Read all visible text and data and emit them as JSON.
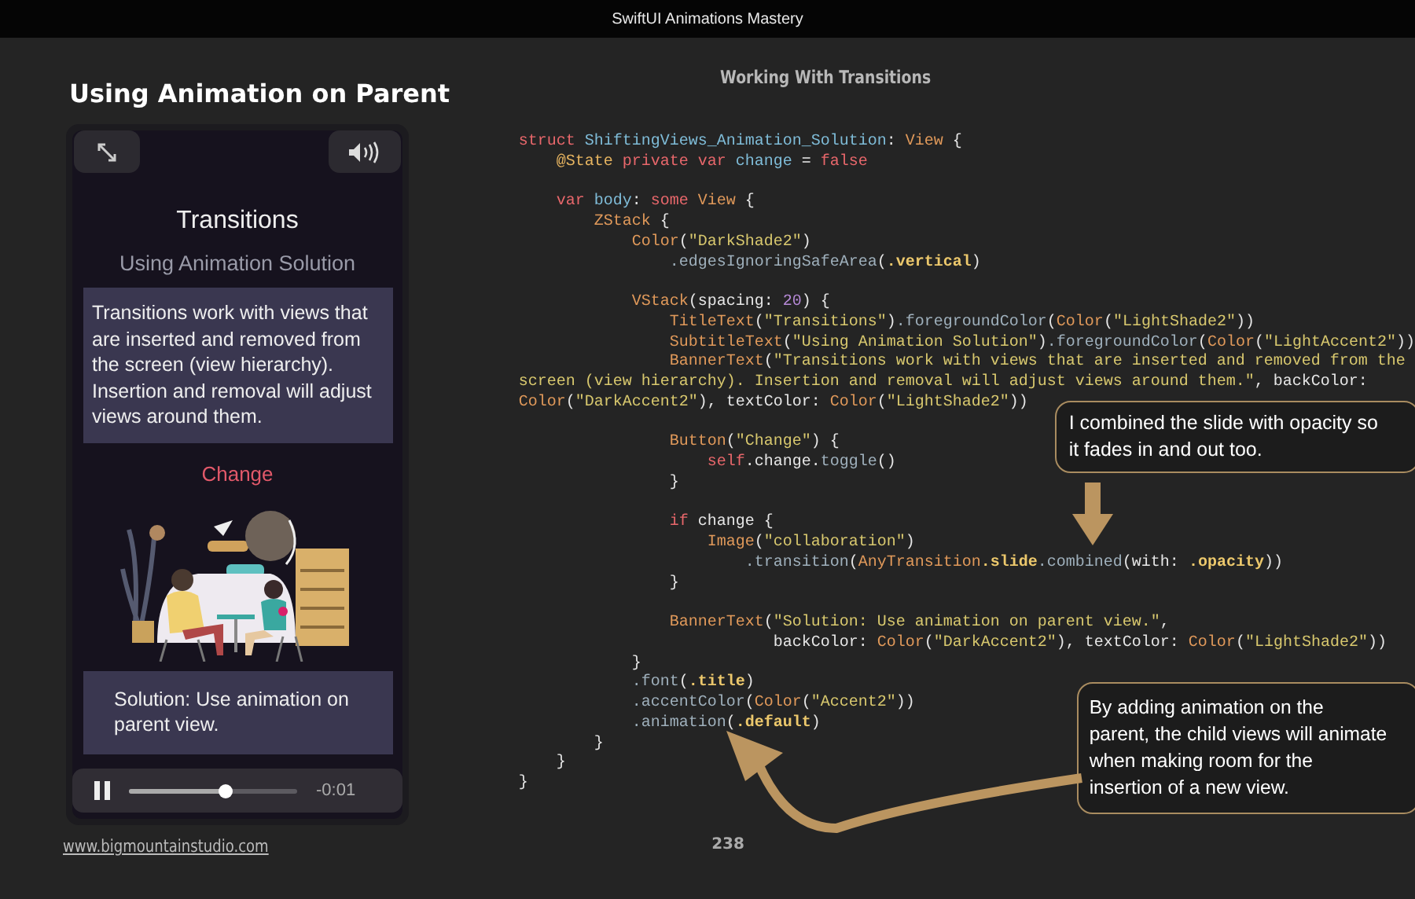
{
  "header": {
    "title": "SwiftUI Animations Mastery"
  },
  "page_heading": "Using Animation on Parent",
  "section_heading": "Working With Transitions",
  "phone": {
    "title": "Transitions",
    "subtitle": "Using Animation Solution",
    "banner": "Transitions work with views that are inserted and removed from the screen (view hierarchy). Insertion and removal will adjust views around them.",
    "button": "Change",
    "solution": "Solution: Use animation on parent view.",
    "player": {
      "playing": true,
      "level": 0.57,
      "time": "-0:01"
    }
  },
  "code": [
    {
      "tokens": [
        {
          "kind": "kw",
          "text": "struct "
        },
        {
          "kind": "ident",
          "text": "ShiftingViews_Animation_Solution"
        },
        {
          "kind": "plain",
          "text": ": "
        },
        {
          "kind": "type",
          "text": "View"
        },
        {
          "kind": "plain",
          "text": " {"
        }
      ]
    },
    {
      "tokens": [
        {
          "kind": "attr",
          "text": "    @State"
        },
        {
          "kind": "kw",
          "text": " private var "
        },
        {
          "kind": "ident",
          "text": "change"
        },
        {
          "kind": "plain",
          "text": " = "
        },
        {
          "kind": "kw",
          "text": "false"
        }
      ]
    },
    {
      "gap_before": true,
      "tokens": [
        {
          "kind": "kw",
          "text": "    var "
        },
        {
          "kind": "ident",
          "text": "body"
        },
        {
          "kind": "plain",
          "text": ": "
        },
        {
          "kind": "kw",
          "text": "some "
        },
        {
          "kind": "type",
          "text": "View"
        },
        {
          "kind": "plain",
          "text": " {"
        }
      ]
    },
    {
      "tokens": [
        {
          "kind": "type",
          "text": "        ZStack"
        },
        {
          "kind": "plain",
          "text": " {"
        }
      ]
    },
    {
      "tokens": [
        {
          "kind": "type",
          "text": "            Color"
        },
        {
          "kind": "plain",
          "text": "("
        },
        {
          "kind": "str",
          "text": "\"DarkShade2\""
        },
        {
          "kind": "plain",
          "text": ")"
        }
      ]
    },
    {
      "tokens": [
        {
          "kind": "method",
          "text": "                .edgesIgnoringSafeArea"
        },
        {
          "kind": "plain",
          "text": "("
        },
        {
          "kind": "member",
          "text": ".vertical"
        },
        {
          "kind": "plain",
          "text": ")"
        }
      ]
    },
    {
      "gap_before": true,
      "tokens": [
        {
          "kind": "type",
          "text": "            VStack"
        },
        {
          "kind": "plain",
          "text": "(spacing: "
        },
        {
          "kind": "num",
          "text": "20"
        },
        {
          "kind": "plain",
          "text": ") {"
        }
      ]
    },
    {
      "tokens": [
        {
          "kind": "type",
          "text": "                TitleText"
        },
        {
          "kind": "plain",
          "text": "("
        },
        {
          "kind": "str",
          "text": "\"Transitions\""
        },
        {
          "kind": "plain",
          "text": ")"
        },
        {
          "kind": "method",
          "text": ".foregroundColor"
        },
        {
          "kind": "plain",
          "text": "("
        },
        {
          "kind": "type",
          "text": "Color"
        },
        {
          "kind": "plain",
          "text": "("
        },
        {
          "kind": "str",
          "text": "\"LightShade2\""
        },
        {
          "kind": "plain",
          "text": "))"
        }
      ]
    },
    {
      "tokens": [
        {
          "kind": "type",
          "text": "                SubtitleText"
        },
        {
          "kind": "plain",
          "text": "("
        },
        {
          "kind": "str",
          "text": "\"Using Animation Solution\""
        },
        {
          "kind": "plain",
          "text": ")"
        },
        {
          "kind": "method",
          "text": ".foregroundColor"
        },
        {
          "kind": "plain",
          "text": "("
        },
        {
          "kind": "type",
          "text": "Color"
        },
        {
          "kind": "plain",
          "text": "("
        },
        {
          "kind": "str",
          "text": "\"LightAccent2\""
        },
        {
          "kind": "plain",
          "text": "))"
        }
      ]
    },
    {
      "tokens": [
        {
          "kind": "type",
          "text": "                BannerText"
        },
        {
          "kind": "plain",
          "text": "("
        },
        {
          "kind": "str",
          "text": "\"Transitions work with views that are inserted and removed from the"
        }
      ]
    },
    {
      "tokens": [
        {
          "kind": "str",
          "text": "screen (view hierarchy). Insertion and removal will adjust views around them.\""
        },
        {
          "kind": "plain",
          "text": ", backColor:"
        }
      ]
    },
    {
      "tokens": [
        {
          "kind": "type",
          "text": "Color"
        },
        {
          "kind": "plain",
          "text": "("
        },
        {
          "kind": "str",
          "text": "\"DarkAccent2\""
        },
        {
          "kind": "plain",
          "text": "), textColor: "
        },
        {
          "kind": "type",
          "text": "Color"
        },
        {
          "kind": "plain",
          "text": "("
        },
        {
          "kind": "str",
          "text": "\"LightShade2\""
        },
        {
          "kind": "plain",
          "text": "))"
        }
      ]
    },
    {
      "gap_before": true,
      "tokens": [
        {
          "kind": "type",
          "text": "                Button"
        },
        {
          "kind": "plain",
          "text": "("
        },
        {
          "kind": "str",
          "text": "\"Change\""
        },
        {
          "kind": "plain",
          "text": ") {"
        }
      ]
    },
    {
      "tokens": [
        {
          "kind": "kw",
          "text": "                    self"
        },
        {
          "kind": "plain",
          "text": ".change."
        },
        {
          "kind": "method",
          "text": "toggle"
        },
        {
          "kind": "plain",
          "text": "()"
        }
      ]
    },
    {
      "tokens": [
        {
          "kind": "plain",
          "text": "                }"
        }
      ]
    },
    {
      "gap_before": true,
      "tokens": [
        {
          "kind": "kw",
          "text": "                if "
        },
        {
          "kind": "plain",
          "text": "change {"
        }
      ]
    },
    {
      "tokens": [
        {
          "kind": "type",
          "text": "                    Image"
        },
        {
          "kind": "plain",
          "text": "("
        },
        {
          "kind": "str",
          "text": "\"collaboration\""
        },
        {
          "kind": "plain",
          "text": ")"
        }
      ]
    },
    {
      "tokens": [
        {
          "kind": "method",
          "text": "                        .transition"
        },
        {
          "kind": "plain",
          "text": "("
        },
        {
          "kind": "type",
          "text": "AnyTransition"
        },
        {
          "kind": "member",
          "text": ".slide"
        },
        {
          "kind": "method",
          "text": ".combined"
        },
        {
          "kind": "plain",
          "text": "(with: "
        },
        {
          "kind": "member",
          "text": ".opacity"
        },
        {
          "kind": "plain",
          "text": "))"
        }
      ]
    },
    {
      "tokens": [
        {
          "kind": "plain",
          "text": "                }"
        }
      ]
    },
    {
      "gap_before": true,
      "tokens": [
        {
          "kind": "type",
          "text": "                BannerText"
        },
        {
          "kind": "plain",
          "text": "("
        },
        {
          "kind": "str",
          "text": "\"Solution: Use animation on parent view.\""
        },
        {
          "kind": "plain",
          "text": ","
        }
      ]
    },
    {
      "tokens": [
        {
          "kind": "plain",
          "text": "                           backColor: "
        },
        {
          "kind": "type",
          "text": "Color"
        },
        {
          "kind": "plain",
          "text": "("
        },
        {
          "kind": "str",
          "text": "\"DarkAccent2\""
        },
        {
          "kind": "plain",
          "text": "), textColor: "
        },
        {
          "kind": "type",
          "text": "Color"
        },
        {
          "kind": "plain",
          "text": "("
        },
        {
          "kind": "str",
          "text": "\"LightShade2\""
        },
        {
          "kind": "plain",
          "text": "))"
        }
      ]
    },
    {
      "tokens": [
        {
          "kind": "plain",
          "text": "            }"
        }
      ]
    },
    {
      "tokens": [
        {
          "kind": "method",
          "text": "            .font"
        },
        {
          "kind": "plain",
          "text": "("
        },
        {
          "kind": "member",
          "text": ".title"
        },
        {
          "kind": "plain",
          "text": ")"
        }
      ]
    },
    {
      "tokens": [
        {
          "kind": "method",
          "text": "            .accentColor"
        },
        {
          "kind": "plain",
          "text": "("
        },
        {
          "kind": "type",
          "text": "Color"
        },
        {
          "kind": "plain",
          "text": "("
        },
        {
          "kind": "str",
          "text": "\"Accent2\""
        },
        {
          "kind": "plain",
          "text": "))"
        }
      ]
    },
    {
      "tokens": [
        {
          "kind": "method",
          "text": "            .animation"
        },
        {
          "kind": "plain",
          "text": "("
        },
        {
          "kind": "member",
          "text": ".default"
        },
        {
          "kind": "plain",
          "text": ")"
        }
      ]
    },
    {
      "tokens": [
        {
          "kind": "plain",
          "text": "        }"
        }
      ]
    },
    {
      "tokens": [
        {
          "kind": "plain",
          "text": "    }"
        }
      ]
    },
    {
      "tokens": [
        {
          "kind": "plain",
          "text": "}"
        }
      ]
    }
  ],
  "callouts": [
    {
      "text": "I combined the slide with opacity so\nit fades in and out too."
    },
    {
      "text": "By adding animation on the\nparent, the child views will animate\nwhen making room for the\ninsertion of a new view."
    }
  ],
  "footer": {
    "link": "www.bigmountainstudio.com",
    "page": "238"
  }
}
